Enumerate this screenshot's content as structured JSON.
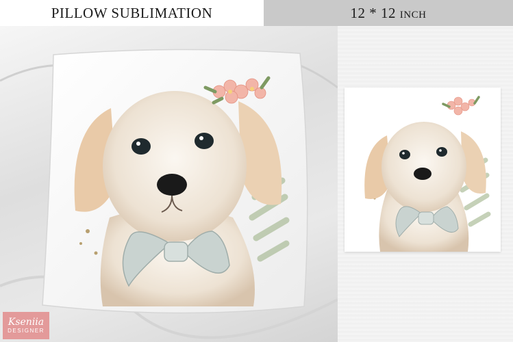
{
  "banner": {
    "left_title": "PILLOW SUBLIMATION",
    "right_title": "12 * 12 inch"
  },
  "logo": {
    "line1": "Kseniia",
    "line2": "DESIGNER"
  },
  "colors": {
    "banner_left_bg": "#ffffff",
    "banner_right_bg": "#c9c9c9",
    "logo_bg": "#e39a9a",
    "bow": "#c9d3d0",
    "flowers": "#f2b5a8"
  }
}
